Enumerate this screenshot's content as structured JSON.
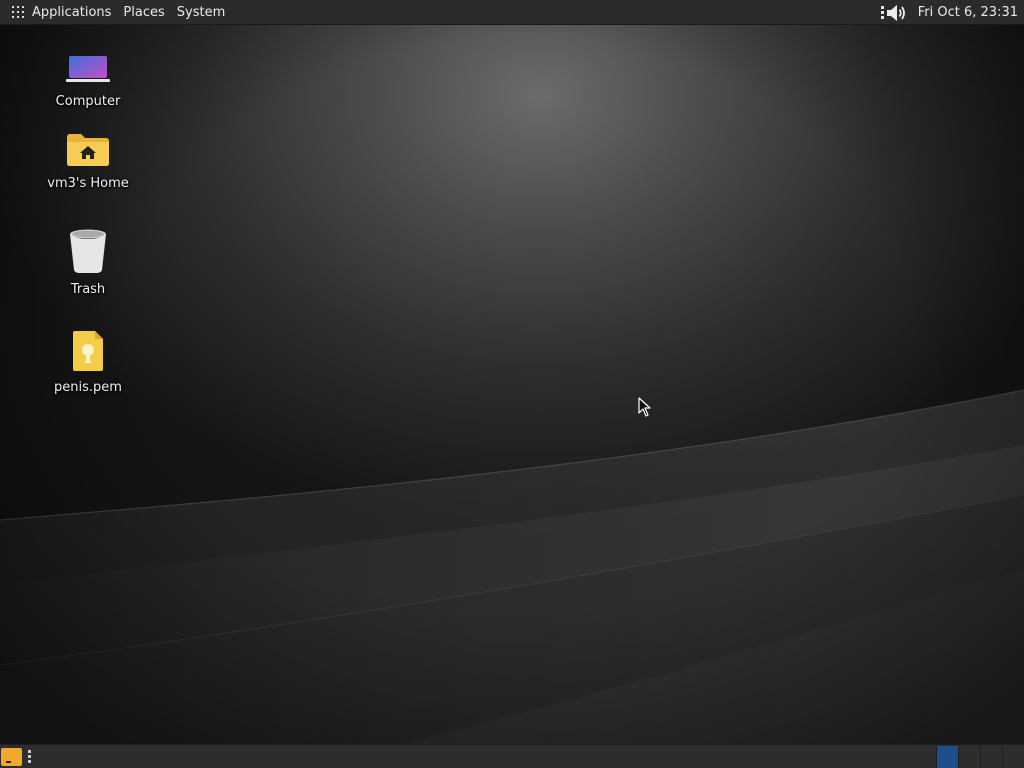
{
  "top_panel": {
    "menus": [
      {
        "label": "Applications"
      },
      {
        "label": "Places"
      },
      {
        "label": "System"
      }
    ],
    "volume_icon": "speaker-volume-icon",
    "clock": "Fri Oct  6, 23:31"
  },
  "desktop": {
    "icons": [
      {
        "label": "Computer",
        "icon": "computer-icon"
      },
      {
        "label": "vm3's Home",
        "icon": "home-folder-icon"
      },
      {
        "label": "Trash",
        "icon": "trash-icon"
      },
      {
        "label": "penis.pem",
        "icon": "certificate-file-icon"
      }
    ]
  },
  "bottom_panel": {
    "show_desktop_icon": "show-desktop-icon",
    "workspaces": 4,
    "active_workspace": 1
  },
  "colors": {
    "panel": "#2b2b2b",
    "folder": "#f5c542",
    "workspace_active": "#1f4f8a"
  }
}
